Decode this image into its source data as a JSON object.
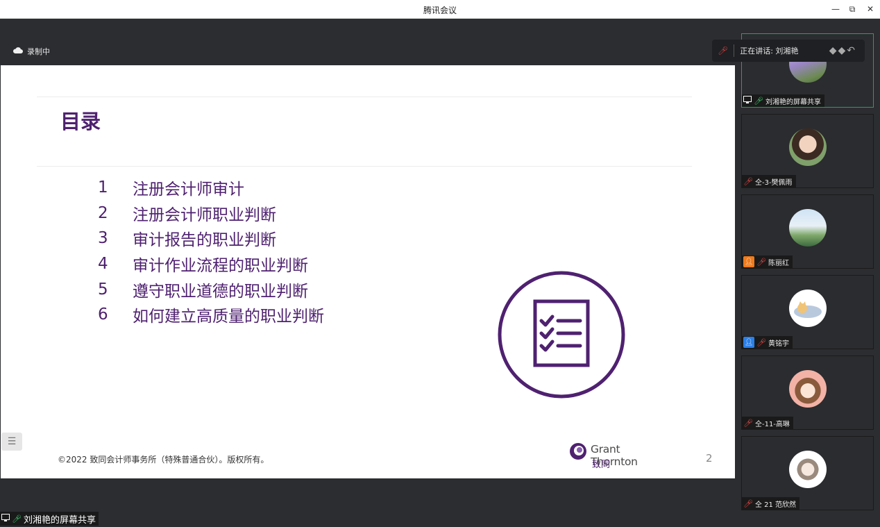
{
  "window": {
    "title": "腾讯会议",
    "minimize": "—",
    "restore": "⧉",
    "close": "✕"
  },
  "recording": {
    "label": "录制中"
  },
  "speaking": {
    "label": "正在讲话: 刘湘艳"
  },
  "slide": {
    "title": "目录",
    "items": [
      {
        "num": "1",
        "text": "注册会计师审计"
      },
      {
        "num": "2",
        "text": "注册会计师职业判断"
      },
      {
        "num": "3",
        "text": "审计报告的职业判断"
      },
      {
        "num": "4",
        "text": "审计作业流程的职业判断"
      },
      {
        "num": "5",
        "text": "遵守职业道德的职业判断"
      },
      {
        "num": "6",
        "text": "如何建立高质量的职业判断"
      }
    ],
    "copyright": "©2022 致同会计师事务所（特殊普通合伙）。版权所有。",
    "brand_en": "Grant Thornton",
    "brand_cn": "致同",
    "page_number": "2",
    "accent_color": "#4f2170"
  },
  "toc_toggle": {
    "icon": "list-icon"
  },
  "share_label": {
    "text": "刘湘艳的屏幕共享"
  },
  "participants": [
    {
      "name": "刘湘艳的屏幕共享",
      "mic": "on",
      "screen": true
    },
    {
      "name": "仝-3-樊佩雨",
      "mic": "off"
    },
    {
      "name": "陈丽红",
      "mic": "off",
      "user_badge": "#f07a1a"
    },
    {
      "name": "黄铭宇",
      "mic": "off",
      "user_badge": "#2a7fe8"
    },
    {
      "name": "仝-11-高琳",
      "mic": "off"
    },
    {
      "name": "仝 21 范欣然",
      "mic": "off"
    }
  ]
}
